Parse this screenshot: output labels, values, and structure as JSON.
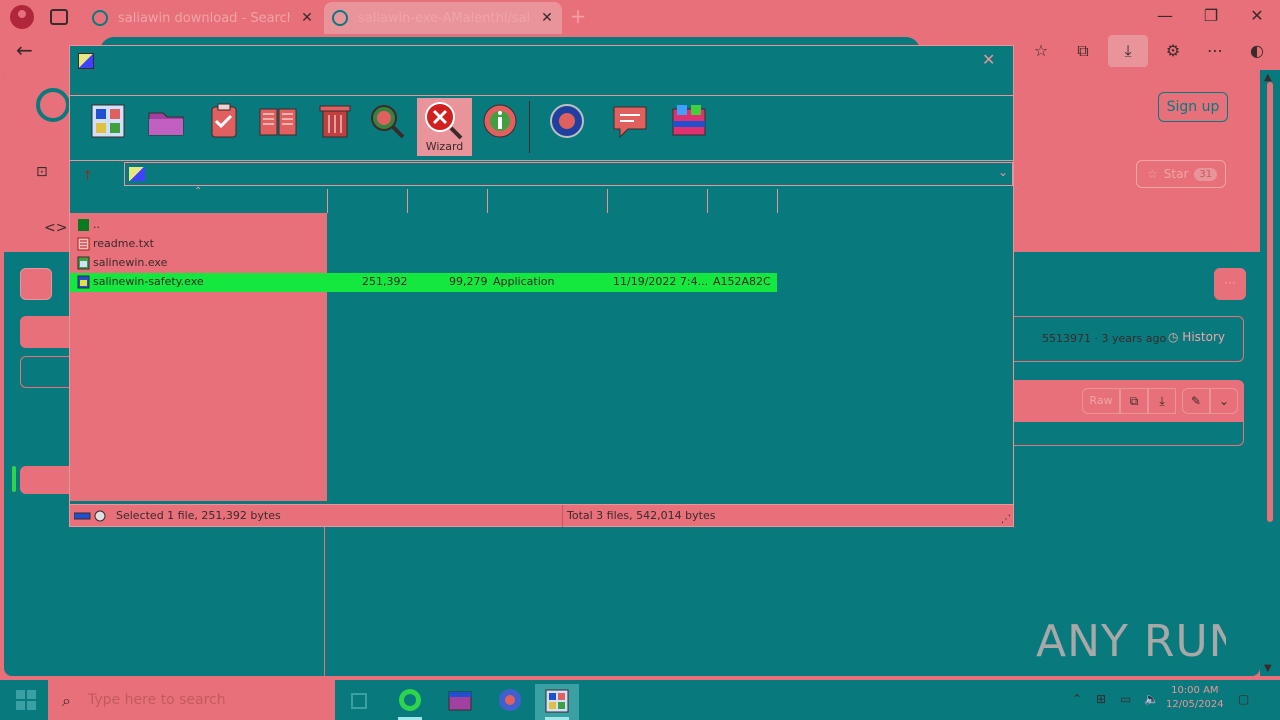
{
  "browser": {
    "tabs": [
      {
        "label": "saliawin download - Search"
      },
      {
        "label": "saliawin-exe-AMalenthi/saliawin"
      }
    ],
    "new_tab_label": "+",
    "window_controls": {
      "minimize": "—",
      "restore": "❐",
      "close": "✕"
    }
  },
  "github": {
    "sign_up": "Sign up",
    "star_label": "Star",
    "star_count": "31",
    "code_tab": "<>",
    "commit_info": "5513971 · 3 years ago",
    "history_label": "History",
    "raw_label": "Raw",
    "more_label": "···"
  },
  "file_manager": {
    "toolbar": {
      "wizard_label": "Wizard"
    },
    "address": "",
    "files": [
      {
        "name": "..",
        "size": "",
        "packed": "",
        "type": "",
        "modified": "",
        "crc": ""
      },
      {
        "name": "readme.txt",
        "size": "",
        "packed": "",
        "type": "",
        "modified": "",
        "crc": ""
      },
      {
        "name": "salinewin.exe",
        "size": "",
        "packed": "",
        "type": "",
        "modified": "",
        "crc": ""
      },
      {
        "name": "salinewin-safety.exe",
        "size": "251,392",
        "packed": "99,279",
        "type": "Application",
        "modified": "11/19/2022 7:4...",
        "crc": "A152A82C"
      }
    ],
    "status_selected": "Selected 1 file, 251,392 bytes",
    "status_total": "Total 3 files, 542,014 bytes"
  },
  "taskbar": {
    "search_placeholder": "Type here to search",
    "time": "10:00 AM",
    "date": "12/05/2024"
  },
  "watermark": "ANY RUN",
  "colors": {
    "accent_teal": "#087a7e",
    "accent_pink": "#e8707a",
    "selection_green": "#14e83e"
  }
}
